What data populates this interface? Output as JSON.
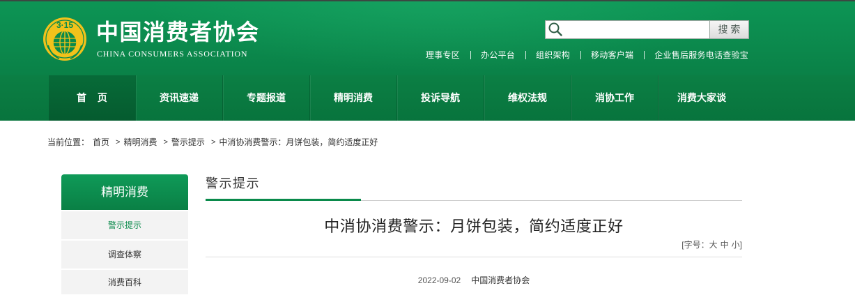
{
  "header": {
    "logo_mark": "3·15",
    "site_name": "中国消费者协会",
    "site_name_en": "CHINA CONSUMERS ASSOCIATION",
    "search": {
      "value": "",
      "button_label": "搜 索"
    },
    "top_links": [
      "理事专区",
      "办公平台",
      "组织架构",
      "移动客户端",
      "企业售后服务电话查验宝"
    ]
  },
  "nav": {
    "items": [
      {
        "label": "首 页",
        "active": true
      },
      {
        "label": "资讯速递"
      },
      {
        "label": "专题报道"
      },
      {
        "label": "精明消费"
      },
      {
        "label": "投诉导航"
      },
      {
        "label": "维权法规"
      },
      {
        "label": "消协工作"
      },
      {
        "label": "消费大家谈"
      }
    ]
  },
  "breadcrumb": {
    "prefix": "当前位置：",
    "separator": ">",
    "items": [
      "首页",
      "精明消费",
      "警示提示",
      "中消协消费警示：月饼包装，简约适度正好"
    ]
  },
  "sidebar": {
    "title": "精明消费",
    "items": [
      {
        "label": "警示提示",
        "active": true
      },
      {
        "label": "调查体察"
      },
      {
        "label": "消费百科"
      }
    ]
  },
  "main": {
    "section_title": "警示提示",
    "article": {
      "title": "中消协消费警示：月饼包装，简约适度正好",
      "font_size_control": {
        "prefix": "[字号：",
        "options": [
          "大",
          "中",
          "小"
        ],
        "suffix": "]"
      },
      "date": "2022-09-02",
      "source": "中国消费者协会"
    }
  },
  "colors": {
    "brand_green": "#0a8a4b",
    "header_green_top": "#0d9555",
    "header_green_bottom": "#0a8147",
    "nav_green_top": "#0b7f44",
    "nav_green_bottom": "#08743d",
    "nav_active_top": "#076b38",
    "nav_active_bottom": "#055b2f",
    "sidebar_green_top": "#0f9a58",
    "sidebar_green_bottom": "#0a8045",
    "sidebar_item_bg": "#f3f3f3",
    "logo_gold": "#f2c21b"
  }
}
